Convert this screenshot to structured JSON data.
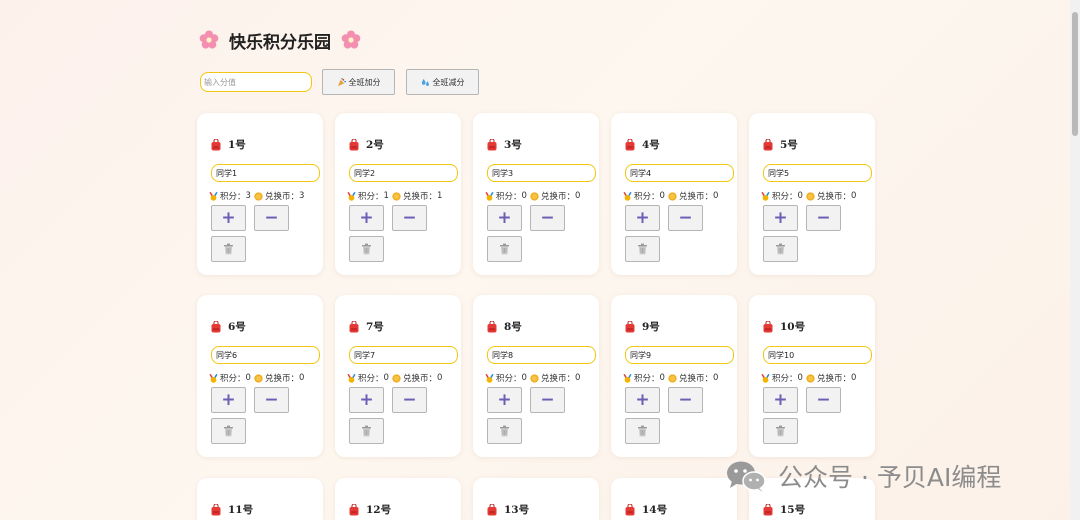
{
  "title": "快乐积分乐园",
  "toolbar": {
    "score_placeholder": "输入分值",
    "add_all_label": "全班加分",
    "sub_all_label": "全班减分"
  },
  "labels": {
    "points": "积分：",
    "coins": "兑换币："
  },
  "buttons": {
    "plus": "+",
    "minus": "−"
  },
  "students": [
    {
      "number": "1号",
      "name": "同学1",
      "points": "3",
      "coins": "3"
    },
    {
      "number": "2号",
      "name": "同学2",
      "points": "1",
      "coins": "1"
    },
    {
      "number": "3号",
      "name": "同学3",
      "points": "0",
      "coins": "0"
    },
    {
      "number": "4号",
      "name": "同学4",
      "points": "0",
      "coins": "0"
    },
    {
      "number": "5号",
      "name": "同学5",
      "points": "0",
      "coins": "0"
    },
    {
      "number": "6号",
      "name": "同学6",
      "points": "0",
      "coins": "0"
    },
    {
      "number": "7号",
      "name": "同学7",
      "points": "0",
      "coins": "0"
    },
    {
      "number": "8号",
      "name": "同学8",
      "points": "0",
      "coins": "0"
    },
    {
      "number": "9号",
      "name": "同学9",
      "points": "0",
      "coins": "0"
    },
    {
      "number": "10号",
      "name": "同学10",
      "points": "0",
      "coins": "0"
    },
    {
      "number": "11号"
    },
    {
      "number": "12号"
    },
    {
      "number": "13号"
    },
    {
      "number": "14号"
    },
    {
      "number": "15号"
    }
  ],
  "watermark": {
    "text": "公众号 · 予贝AI编程"
  },
  "colors": {
    "accent_border": "#f2c611",
    "button_glyph": "#6b5fb5",
    "bag": "#e53935"
  }
}
